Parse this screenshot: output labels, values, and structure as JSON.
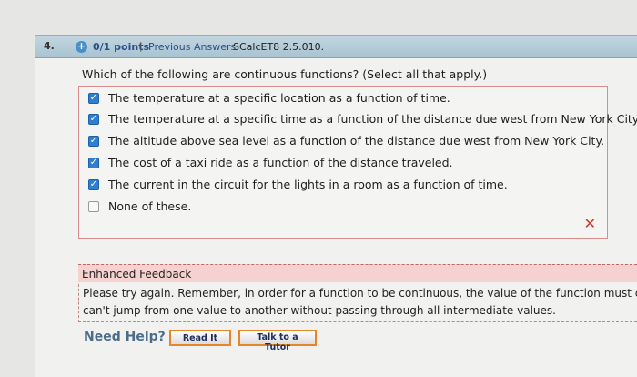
{
  "question": {
    "number": "4.",
    "points": "0/1 points",
    "separator": "|",
    "previous_answers": "Previous Answers",
    "source": "SCalcET8 2.5.010.",
    "prompt": "Which of the following are continuous functions? (Select all that apply.)"
  },
  "choices": [
    {
      "label": "The temperature at a specific location as a function of time.",
      "checked": true
    },
    {
      "label": "The temperature at a specific time as a function of the distance due west from New York City.",
      "checked": true
    },
    {
      "label": "The altitude above sea level as a function of the distance due west from New York City.",
      "checked": true
    },
    {
      "label": "The cost of a taxi ride as a function of the distance traveled.",
      "checked": true
    },
    {
      "label": "The current in the circuit for the lights in a room as a function of time.",
      "checked": true
    },
    {
      "label": "None of these.",
      "checked": false
    }
  ],
  "feedback": {
    "title": "Enhanced Feedback",
    "line1": "Please try again. Remember, in order for a function to be continuous, the value of the function must cha",
    "line2": "can't jump from one value to another without passing through all intermediate values."
  },
  "help": {
    "label": "Need Help?",
    "read_it": "Read It",
    "talk_to_tutor": "Talk to a Tutor"
  },
  "colors": {
    "checked": "#2f7fd0",
    "incorrect_mark": "#d0342c",
    "feedback_bg": "#f5d2cf",
    "button_border": "#e6862b"
  }
}
